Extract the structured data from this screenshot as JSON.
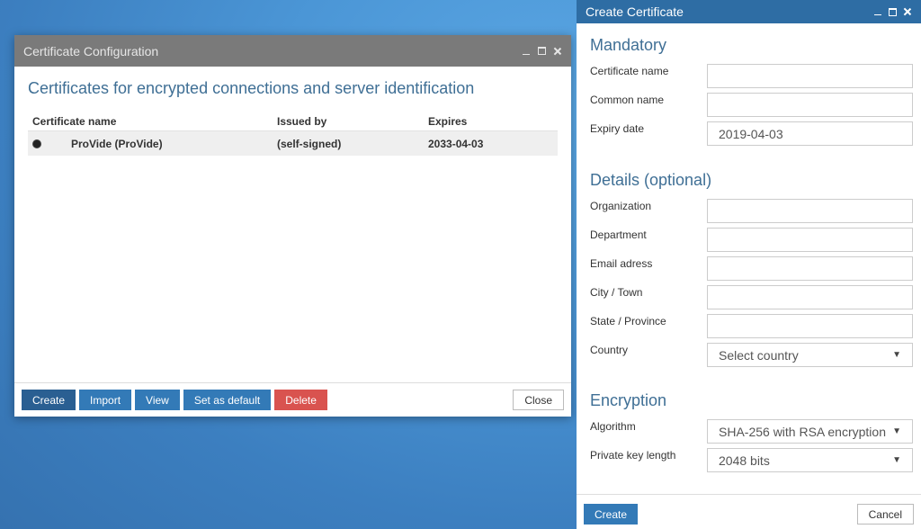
{
  "cert_dialog": {
    "title": "Certificate Configuration",
    "heading": "Certificates for encrypted connections and server identification",
    "columns": [
      "Certificate name",
      "Issued by",
      "Expires"
    ],
    "rows": [
      {
        "name": "ProVide (ProVide)",
        "issued_by": "(self-signed)",
        "expires": "2033-04-03"
      }
    ],
    "buttons": {
      "create": "Create",
      "import": "Import",
      "view": "View",
      "set_default": "Set as default",
      "delete": "Delete",
      "close": "Close"
    }
  },
  "create_dialog": {
    "title": "Create Certificate",
    "mandatory": {
      "title": "Mandatory",
      "cert_name_label": "Certificate name",
      "cert_name_value": "",
      "common_name_label": "Common name",
      "common_name_value": "",
      "expiry_label": "Expiry date",
      "expiry_value": "2019-04-03"
    },
    "details": {
      "title": "Details (optional)",
      "organization_label": "Organization",
      "department_label": "Department",
      "email_label": "Email adress",
      "city_label": "City / Town",
      "state_label": "State / Province",
      "country_label": "Country",
      "country_value": "Select country"
    },
    "encryption": {
      "title": "Encryption",
      "algorithm_label": "Algorithm",
      "algorithm_value": "SHA-256 with RSA encryption",
      "keylen_label": "Private key length",
      "keylen_value": "2048 bits"
    },
    "buttons": {
      "create": "Create",
      "cancel": "Cancel"
    }
  },
  "colors": {
    "title_gray": "#7a7a7a",
    "title_blue": "#2e6da4",
    "primary_btn": "#337ab7",
    "danger_btn": "#d9534f",
    "heading_text": "#3f6f95"
  }
}
